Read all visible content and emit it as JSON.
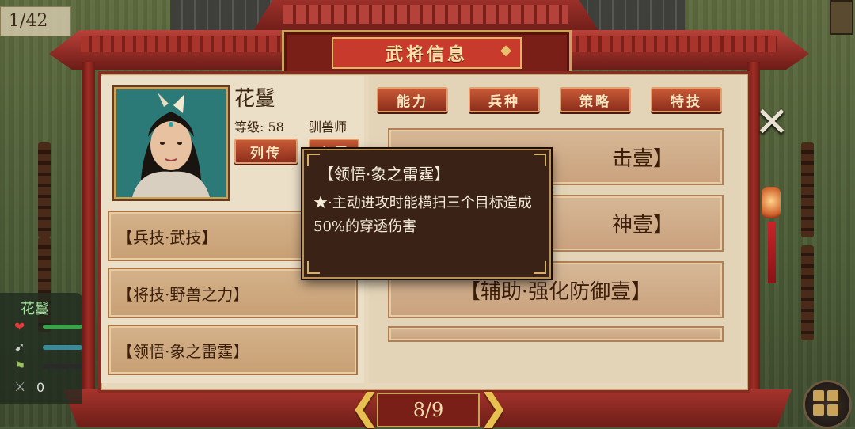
{
  "counter": "1/42",
  "title": "武将信息",
  "hero": {
    "name": "花鬘",
    "level_label": "等级: 58",
    "class": "驯兽师"
  },
  "hero_buttons": {
    "biography": "列传",
    "partial_hidden": "专属"
  },
  "tabs": [
    "能力",
    "兵种",
    "策略",
    "特技"
  ],
  "skills": [
    "【兵技·武技】",
    "【将技·野兽之力】",
    "【领悟·象之雷霆】"
  ],
  "right_slots": [
    "击壹】",
    "神壹】",
    "【辅助·强化防御壹】"
  ],
  "tooltip": {
    "title": "【领悟·象之雷霆】",
    "description": "★·主动进攻时能横扫三个目标造成50%的穿透伤害"
  },
  "pager": {
    "label": "8/9",
    "prev": "❮",
    "next": "❯"
  },
  "unit": {
    "name": "花鬘",
    "count": "0",
    "hp_color": "#3aa24a",
    "speed_color": "#3a8a9a",
    "morale_color": "#2a2a2a"
  },
  "icons": {
    "close": "close-icon",
    "menu": "grid-menu-icon"
  },
  "colors": {
    "frame_red": "#8d2a24",
    "gold": "#caa35a",
    "tooltip_bg": "#3a2216"
  }
}
